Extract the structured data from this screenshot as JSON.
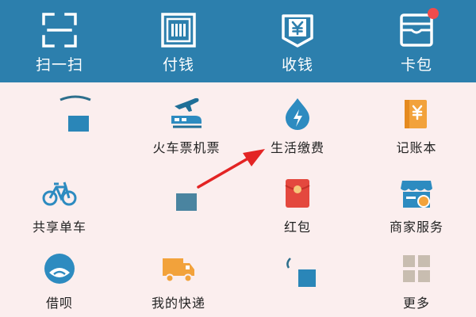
{
  "top_bar": {
    "items": [
      {
        "label": "扫一扫",
        "icon": "scan-icon"
      },
      {
        "label": "付钱",
        "icon": "pay-code-icon"
      },
      {
        "label": "收钱",
        "icon": "receive-money-icon"
      },
      {
        "label": "卡包",
        "icon": "card-wallet-icon",
        "badge_color": "#f04b4b"
      }
    ]
  },
  "grid": {
    "items": [
      {
        "label": "",
        "icon": "obscured-icon"
      },
      {
        "label": "火车票机票",
        "icon": "train-plane-icon"
      },
      {
        "label": "生活缴费",
        "icon": "utility-drop-icon"
      },
      {
        "label": "记账本",
        "icon": "ledger-icon"
      },
      {
        "label": "共享单车",
        "icon": "bicycle-icon"
      },
      {
        "label": "",
        "icon": "obscured-icon"
      },
      {
        "label": "红包",
        "icon": "red-envelope-icon"
      },
      {
        "label": "商家服务",
        "icon": "merchant-store-icon"
      },
      {
        "label": "借呗",
        "icon": "borrow-icon"
      },
      {
        "label": "我的快递",
        "icon": "delivery-truck-icon"
      },
      {
        "label": "",
        "icon": "obscured-icon"
      },
      {
        "label": "更多",
        "icon": "more-grid-icon"
      }
    ]
  },
  "colors": {
    "header": "#2c7fad",
    "background": "#fbeeee",
    "accent_blue": "#2d8bc0",
    "orange": "#f2a23b",
    "red": "#e4483e",
    "arrow": "#e32424"
  }
}
